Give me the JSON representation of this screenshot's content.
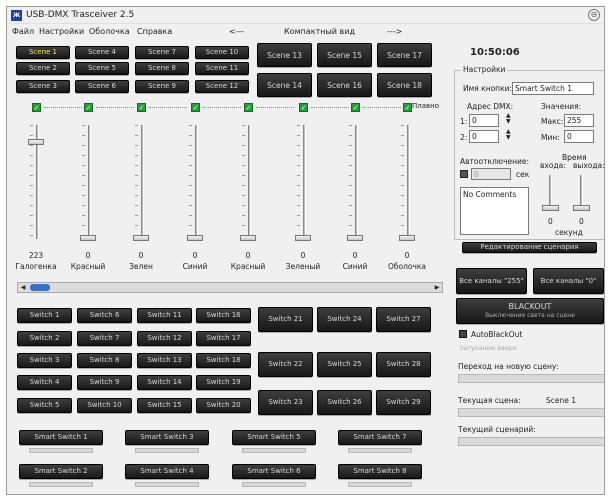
{
  "window": {
    "title": "USB-DMX Trasceiver 2.5",
    "icon": "app-icon"
  },
  "menu": {
    "items": [
      "Файл",
      "Настройки",
      "Оболочка",
      "Справка"
    ],
    "prev_arrow": "<---",
    "view_label": "Компактный вид",
    "next_arrow": "--->"
  },
  "clock": "10:50:06",
  "scenes": [
    "Scene 1",
    "Scene 2",
    "Scene 3",
    "Scene 4",
    "Scene 5",
    "Scene 6",
    "Scene 7",
    "Scene 8",
    "Scene 9",
    "Scene 10",
    "Scene 11",
    "Scene 12",
    "Scene 13",
    "Scene 14",
    "Scene 15",
    "Scene 16",
    "Scene 17",
    "Scene 18"
  ],
  "smooth_label": "Плавно",
  "channels": [
    {
      "name": "Галогенка",
      "value": "223",
      "level": 0.874
    },
    {
      "name": "Красный",
      "value": "0",
      "level": 0
    },
    {
      "name": "Зелен",
      "value": "0",
      "level": 0
    },
    {
      "name": "Синий",
      "value": "0",
      "level": 0
    },
    {
      "name": "Красный",
      "value": "0",
      "level": 0
    },
    {
      "name": "Зеленый",
      "value": "0",
      "level": 0
    },
    {
      "name": "Синий",
      "value": "0",
      "level": 0
    },
    {
      "name": "Оболочка",
      "value": "0",
      "level": 0
    }
  ],
  "switches": [
    "Switch 1",
    "Switch 2",
    "Switch 3",
    "Switch 4",
    "Switch 5",
    "Switch 6",
    "Switch 7",
    "Switch 8",
    "Switch 9",
    "Switch 10",
    "Switch 11",
    "Switch 12",
    "Switch 13",
    "Switch 14",
    "Switch 15",
    "Switch 16",
    "Switch 17",
    "Switch 18",
    "Switch 19",
    "Switch 20",
    "Switch 21",
    "Switch 22",
    "Switch 23",
    "Switch 24",
    "Switch 25",
    "Switch 26",
    "Switch 27",
    "Switch 28",
    "Switch 29"
  ],
  "smart_switches": [
    "Smart Switch 1",
    "Smart Switch 2",
    "Smart Switch 3",
    "Smart Switch 4",
    "Smart Switch 5",
    "Smart Switch 6",
    "Smart Switch 7",
    "Smart Switch 8"
  ],
  "settings": {
    "group_title": "Настройки",
    "button_name_label": "Имя кнопки:",
    "button_name_value": "Smart Switch 1",
    "dmx_address_label": "Адрес DMX:",
    "addr1_label": "1:",
    "addr1_value": "0",
    "addr2_label": "2:",
    "addr2_value": "0",
    "values_label": "Значения:",
    "max_label": "Макс:",
    "max_value": "255",
    "min_label": "Мин:",
    "min_value": "0",
    "auto_off_label": "Автоотключение:",
    "auto_off_value": "0",
    "sec_label": "сек",
    "time_label": "Время",
    "in_label": "входа:",
    "out_label": "выхода:",
    "fade_in_value": "0",
    "fade_out_value": "0",
    "seconds_label": "секунд",
    "comments": "No Comments"
  },
  "edit_scenario_button": "Редактирование сценария",
  "all_255_button": "Все каналы \"255\"",
  "all_0_button": "Все каналы \"0\"",
  "blackout": {
    "title": "BLACKOUT",
    "subtitle": "Выключение света на сцене"
  },
  "auto_blackout_label": "AutoBlackOut",
  "faded_label": "Затухание вверх",
  "transition_label": "Переход на новую сцену:",
  "current_scene_label": "Текущая сцена:",
  "current_scene_value": "Scene 1",
  "current_scenario_label": "Текущий сценарий:"
}
